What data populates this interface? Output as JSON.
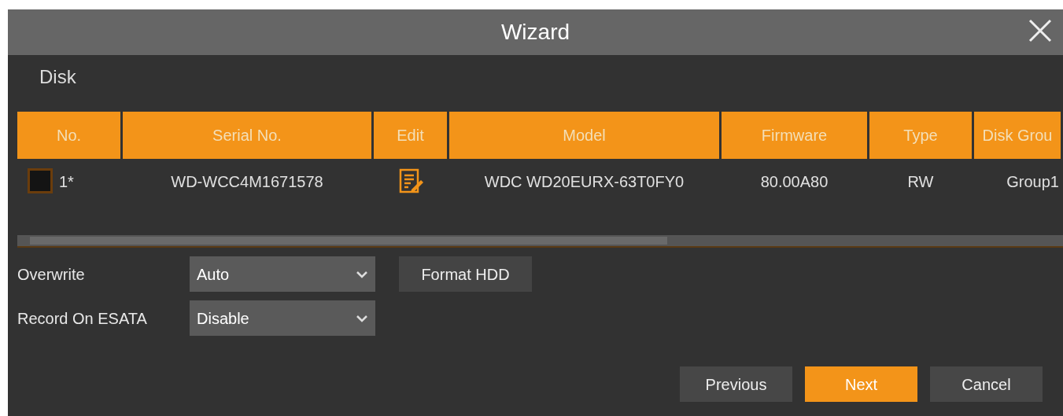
{
  "window": {
    "title": "Wizard"
  },
  "section": "Disk",
  "table": {
    "columns": [
      "No.",
      "Serial No.",
      "Edit",
      "Model",
      "Firmware",
      "Type",
      "Disk Grou"
    ],
    "rows": [
      {
        "checked": false,
        "no": "1*",
        "serial": "WD-WCC4M1671578",
        "model": "WDC WD20EURX-63T0FY0",
        "firmware": "80.00A80",
        "type": "RW",
        "group": "Group1"
      }
    ]
  },
  "settings": [
    {
      "label": "Overwrite",
      "value": "Auto"
    },
    {
      "label": "Record On ESATA",
      "value": "Disable"
    }
  ],
  "format_button": "Format HDD",
  "buttons": [
    {
      "label": "Previous",
      "selected": false
    },
    {
      "label": "Next",
      "selected": true
    },
    {
      "label": "Cancel",
      "selected": false
    }
  ]
}
